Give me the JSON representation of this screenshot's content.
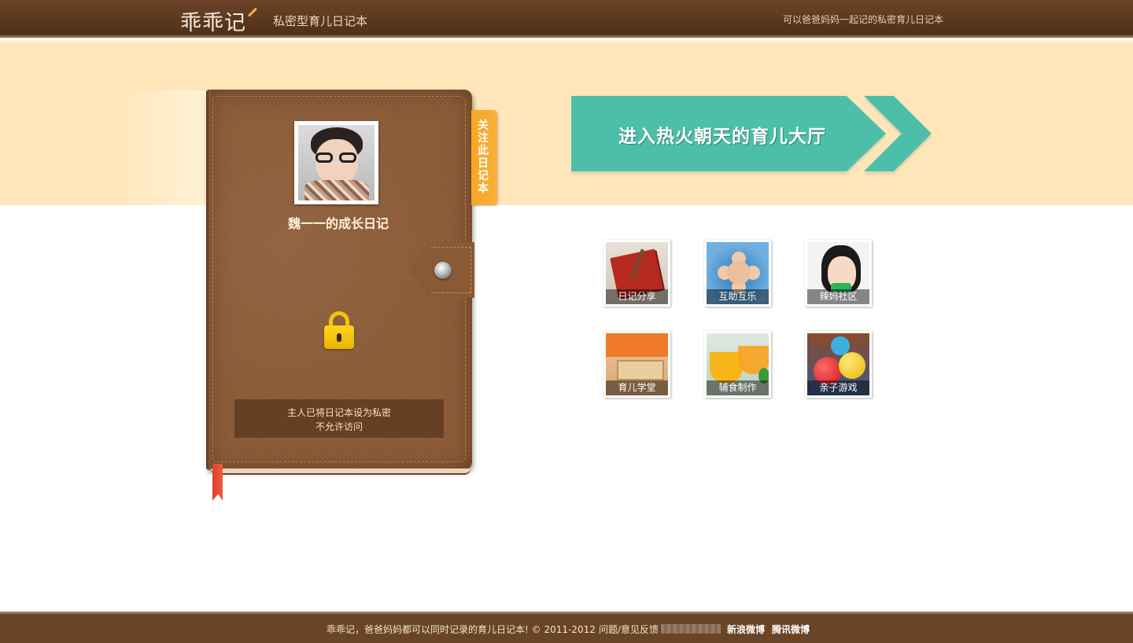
{
  "header": {
    "logo_text": "乖乖记",
    "subtitle": "私密型育儿日记本",
    "slogan": "可以爸爸妈妈一起记的私密育儿日记本"
  },
  "diary": {
    "title": "魏一一的成长日记",
    "follow_label": "关注此日记本",
    "private_line1": "主人已将日记本设为私密",
    "private_line2": "不允许访问"
  },
  "hall_banner": {
    "label": "进入热火朝天的育儿大厅"
  },
  "categories": [
    {
      "label": "日记分享"
    },
    {
      "label": "互助互乐"
    },
    {
      "label": "辣妈社区"
    },
    {
      "label": "育儿学堂"
    },
    {
      "label": "辅食制作"
    },
    {
      "label": "亲子游戏"
    }
  ],
  "footer": {
    "copyright": "乖乖记，爸爸妈妈都可以同时记录的育儿日记本! © 2011-2012",
    "feedback_label": "问题/意见反馈",
    "weibo_label": "新浪微博",
    "tqq_label": "腾讯微博"
  },
  "colors": {
    "header_brown": "#5a381f",
    "band_cream": "#ffe6b9",
    "hall_teal": "#4dbfa8",
    "follow_orange": "#f5a623",
    "footer_brown": "#6a4426"
  }
}
